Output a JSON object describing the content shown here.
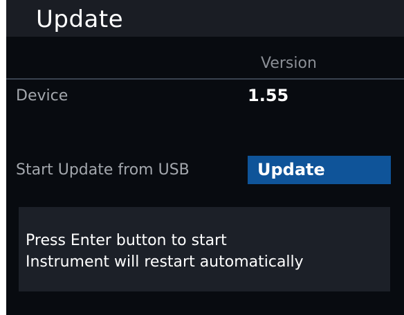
{
  "title": "Update",
  "column_header": "Version",
  "rows": {
    "device": {
      "label": "Device",
      "version": "1.55"
    },
    "usb_update": {
      "label": "Start Update from USB",
      "button_label": "Update"
    }
  },
  "message": {
    "line1": "Press Enter button to start",
    "line2": "Instrument will restart automatically"
  },
  "colors": {
    "background": "#080b10",
    "title_bar": "#1a1d24",
    "button_highlight": "#0f5499",
    "message_box": "#1c2028",
    "label_text": "#a3a7ad",
    "value_text": "#ffffff"
  }
}
